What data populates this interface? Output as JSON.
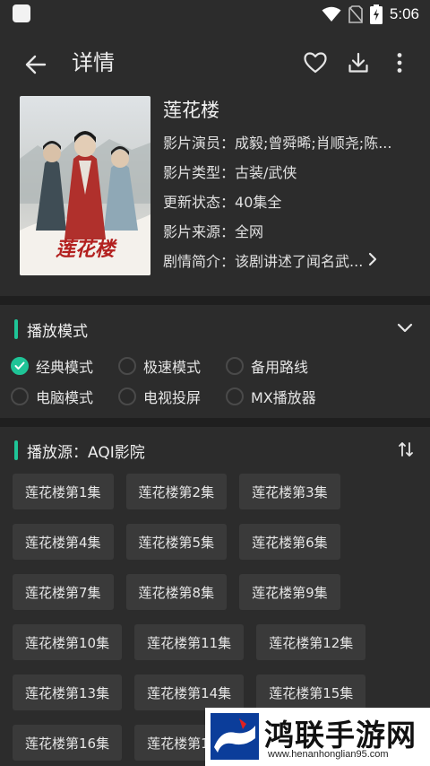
{
  "status_bar": {
    "time": "5:06"
  },
  "header": {
    "title": "详情"
  },
  "detail": {
    "title": "莲花楼",
    "rows": [
      {
        "label": "影片演员：",
        "value": "成毅;曾舜晞;肖顺尧;陈..."
      },
      {
        "label": "影片类型：",
        "value": "古装/武侠"
      },
      {
        "label": "更新状态：",
        "value": "40集全"
      },
      {
        "label": "影片来源：",
        "value": "全网"
      },
      {
        "label": "剧情简介：",
        "value": "该剧讲述了闻名武..."
      }
    ],
    "poster_title": "莲花楼"
  },
  "play_mode": {
    "title": "播放模式",
    "options": [
      {
        "label": "经典模式",
        "selected": true
      },
      {
        "label": "极速模式",
        "selected": false
      },
      {
        "label": "备用路线",
        "selected": false
      },
      {
        "label": "电脑模式",
        "selected": false
      },
      {
        "label": "电视投屏",
        "selected": false
      },
      {
        "label": "MX播放器",
        "selected": false
      }
    ]
  },
  "source": {
    "title": "播放源：AQI影院",
    "episodes": [
      "莲花楼第1集",
      "莲花楼第2集",
      "莲花楼第3集",
      "莲花楼第4集",
      "莲花楼第5集",
      "莲花楼第6集",
      "莲花楼第7集",
      "莲花楼第8集",
      "莲花楼第9集",
      "莲花楼第10集",
      "莲花楼第11集",
      "莲花楼第12集",
      "莲花楼第13集",
      "莲花楼第14集",
      "莲花楼第15集",
      "莲花楼第16集",
      "莲花楼第17集"
    ]
  },
  "watermark": {
    "text": "鸿联手游网",
    "url": "www.henanhonglian95.com"
  },
  "colors": {
    "background": "#2c2c2c",
    "accent": "#1fc497",
    "chip": "#3a3a3a",
    "divider": "#1f1f1f"
  }
}
